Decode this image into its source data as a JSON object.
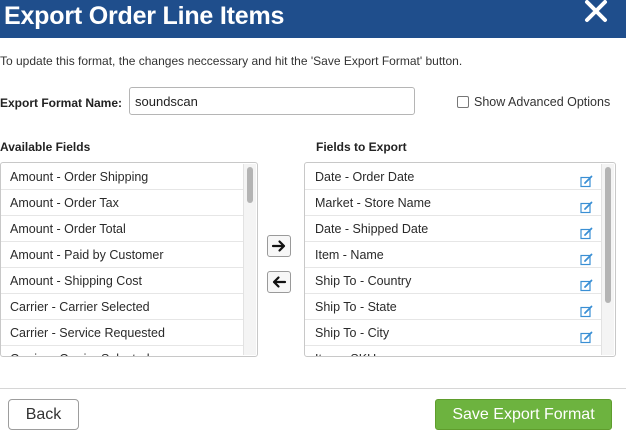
{
  "dialog": {
    "title": "Export Order Line Items",
    "intro": "To update this format, the changes neccessary and hit the 'Save Export Format' button."
  },
  "format": {
    "label": "Export Format Name:",
    "value": "soundscan"
  },
  "advanced": {
    "label": "Show Advanced Options",
    "checked": false
  },
  "available": {
    "title": "Available Fields",
    "items": [
      "Amount - Order Shipping",
      "Amount - Order Tax",
      "Amount - Order Total",
      "Amount - Paid by Customer",
      "Amount - Shipping Cost",
      "Carrier - Carrier Selected",
      "Carrier - Service Requested",
      "Carrier - Carrier Selected"
    ]
  },
  "export": {
    "title": "Fields to Export",
    "items": [
      "Date - Order Date",
      "Market - Store Name",
      "Date - Shipped Date",
      "Item - Name",
      "Ship To - Country",
      "Ship To - State",
      "Ship To - City",
      "Item - SKU"
    ]
  },
  "icons": {
    "close": "close-icon",
    "move_right": "arrow-right-icon",
    "move_left": "arrow-left-icon",
    "edit": "edit-icon"
  },
  "footer": {
    "back_label": "Back",
    "save_label": "Save Export Format"
  },
  "colors": {
    "header_bg": "#1f4e8c",
    "save_bg": "#6db33f",
    "edit_icon": "#3a8fd4"
  }
}
